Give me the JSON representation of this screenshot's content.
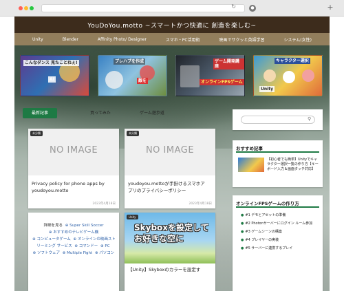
{
  "site": {
    "title": "YouDoYou.motto ~スマートかつ快適に 創造を楽しむ~"
  },
  "nav": [
    "Unity",
    "Blender",
    "Affinity Photo/ Designer",
    "スマホ・PC活用術",
    "映画でサクッと英語学習",
    "システム(女性)"
  ],
  "banners": [
    {
      "line1": "こんなダンス\n見たことねぇ!",
      "line2": "AI"
    },
    {
      "line1": "プレハブを作成",
      "line2": "敵を"
    },
    {
      "line1": "ゲーム開発講座",
      "line2": "オンラインFPSゲーム"
    },
    {
      "line1": "キャラクター選択",
      "line2": "Unity"
    }
  ],
  "tabs": [
    "最新記事",
    "買ってみた",
    "ゲーム遊歩道"
  ],
  "cards": [
    {
      "image_label": "NO IMAGE",
      "tag": "未分類",
      "title": "Privacy policy for phone apps by youdoyou.motto",
      "date": "2023年4月18日"
    },
    {
      "image_label": "NO IMAGE",
      "tag": "未分類",
      "title": "youdoyou.mottoが手掛けるスマホアプリのプライバシーポリシー",
      "date": "2023年4月18日"
    }
  ],
  "tag_cloud": {
    "more_label": "詳細を見る",
    "tags": [
      "Super Skill Soccer",
      "おすすめのテレビゲーム機",
      "コンピュータゲーム",
      "オンラインの映画ストリーミング サービス",
      "コマンドー",
      "PC",
      "ソフトウェア",
      "Multiple Fight",
      "パソコン"
    ]
  },
  "skybox_card": {
    "tag": "Unity",
    "image_text_line1": "Skyboxを設定して",
    "image_text_line2": "お好きな空に",
    "title": "【Unity】Skyboxのカラーを設定す"
  },
  "sidebar": {
    "search_placeholder": "",
    "recommended_heading": "おすすめ記事",
    "recommended_text": "【初心者でも簡単】Unityでキャラクター選択一覧の作り方【キーボード入力＆画面タッチ対応】",
    "fps_heading": "オンラインFPSゲームの作り方",
    "fps_items": [
      "#1 デモとアセットの準備",
      "#2 Photonサーバーにログイン ルーム参加",
      "#3 ゲームシーンの構築",
      "#4 プレイヤーの実装",
      "#5 サーバーに連携するプレイ"
    ]
  },
  "colors": {
    "header_bg": "#3d2c1c",
    "nav_bg": "#aa8c64",
    "accent_green": "#1e7a44",
    "tag_link": "#2b5fa8"
  }
}
